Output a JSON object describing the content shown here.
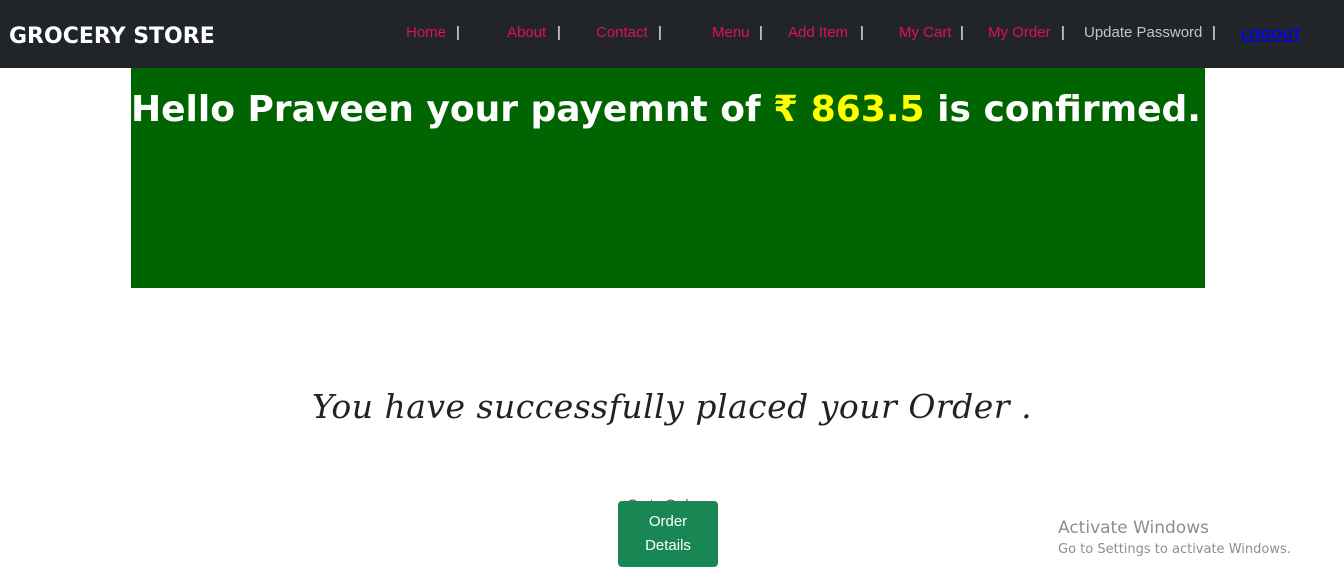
{
  "navbar": {
    "brand": "GROCERY STORE",
    "items": [
      {
        "label": "Home"
      },
      {
        "label": "About"
      },
      {
        "label": "Contact"
      },
      {
        "label": "Menu"
      },
      {
        "label": "Add Item"
      },
      {
        "label": "My Cart"
      },
      {
        "label": "My Order"
      },
      {
        "label": "Update Password"
      }
    ],
    "separator": "|",
    "logout": "LOGOUT"
  },
  "banner": {
    "prefix": "Hello Praveen your payemnt of ",
    "amount": "₹ 863.5",
    "suffix": " is confirmed."
  },
  "main": {
    "success_message": "You have successfully placed your Order .",
    "goto_link": "Go to Order",
    "order_button_line1": "Order",
    "order_button_line2": "Details"
  },
  "watermark": {
    "title": "Activate Windows",
    "subtitle": "Go to Settings to activate Windows."
  },
  "colors": {
    "navbar_bg": "#212529",
    "nav_link": "#e0105f",
    "banner_bg": "#006400",
    "amount": "#ffff00",
    "button_bg": "#198754"
  }
}
